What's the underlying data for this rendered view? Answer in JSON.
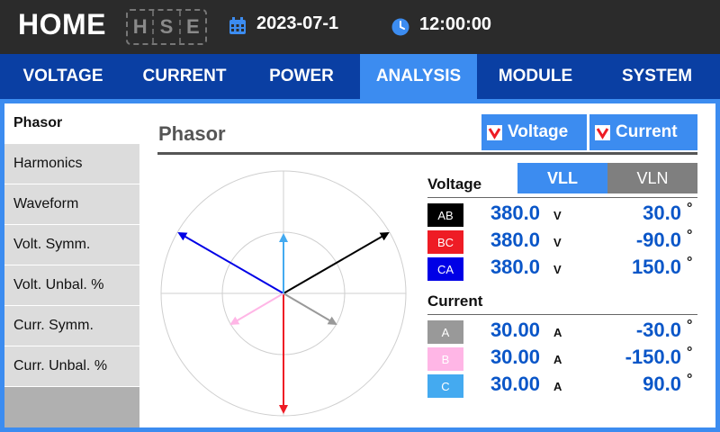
{
  "header": {
    "title": "HOME",
    "hse_letters": [
      "H",
      "S",
      "E"
    ],
    "date": "2023-07-1",
    "time": "12:00:00",
    "calendar_icon": "calendar-icon",
    "clock_icon": "clock-icon"
  },
  "nav": {
    "tabs": [
      {
        "label": "VOLTAGE",
        "active": false
      },
      {
        "label": "CURRENT",
        "active": false
      },
      {
        "label": "POWER",
        "active": false
      },
      {
        "label": "ANALYSIS",
        "active": true
      },
      {
        "label": "MODULE",
        "active": false
      },
      {
        "label": "SYSTEM",
        "active": false
      }
    ]
  },
  "sidebar": {
    "items": [
      {
        "label": "Phasor",
        "active": true
      },
      {
        "label": "Harmonics",
        "active": false
      },
      {
        "label": "Waveform",
        "active": false
      },
      {
        "label": "Volt. Symm.",
        "active": false
      },
      {
        "label": "Volt. Unbal. %",
        "active": false
      },
      {
        "label": "Curr. Symm.",
        "active": false
      },
      {
        "label": "Curr. Unbal. %",
        "active": false
      }
    ]
  },
  "main": {
    "title": "Phasor",
    "toggles": {
      "voltage": {
        "label": "Voltage",
        "checked": true
      },
      "current": {
        "label": "Current",
        "checked": true
      }
    },
    "voltage_label": "Voltage",
    "current_label": "Current",
    "mode": {
      "vll": "VLL",
      "vln": "VLN",
      "selected": "VLL"
    },
    "voltage_rows": [
      {
        "tag": "AB",
        "color": "#000000",
        "value": "380.0",
        "unit": "V",
        "angle": "30.0",
        "deg": "°"
      },
      {
        "tag": "BC",
        "color": "#ee1c25",
        "value": "380.0",
        "unit": "V",
        "angle": "-90.0",
        "deg": "°"
      },
      {
        "tag": "CA",
        "color": "#0000e6",
        "value": "380.0",
        "unit": "V",
        "angle": "150.0",
        "deg": "°"
      }
    ],
    "current_rows": [
      {
        "tag": "A",
        "color": "#999999",
        "value": "30.00",
        "unit": "A",
        "angle": "-30.0",
        "deg": "°"
      },
      {
        "tag": "B",
        "color": "#ffb6e6",
        "value": "30.00",
        "unit": "A",
        "angle": "-150.0",
        "deg": "°"
      },
      {
        "tag": "C",
        "color": "#44aaf0",
        "value": "30.00",
        "unit": "A",
        "angle": "90.0",
        "deg": "°"
      }
    ]
  },
  "colors": {
    "accent": "#3c8cf0",
    "nav": "#0a3fa3",
    "value_blue": "#0a56c8",
    "header_bg": "#2b2b2b",
    "phasor_voltage": [
      "#000000",
      "#ee1c25",
      "#0000e6"
    ],
    "phasor_current": [
      "#999999",
      "#ffb6e6",
      "#44aaf0"
    ]
  }
}
